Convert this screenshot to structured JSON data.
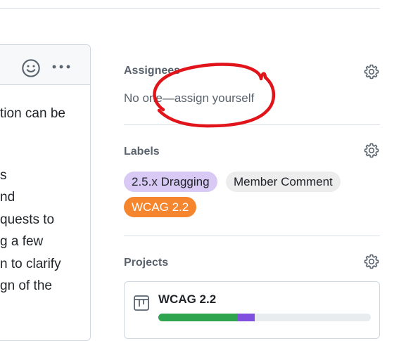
{
  "comment": {
    "lines": [
      "tion can be",
      "",
      "s",
      "nd",
      "quests to",
      "g a few",
      "n to clarify",
      "gn of the"
    ]
  },
  "sidebar": {
    "assignees": {
      "title": "Assignees",
      "empty_text": "No one—assign yourself"
    },
    "labels": {
      "title": "Labels",
      "items": [
        {
          "text": "2.5.x Dragging",
          "bg": "#d8c9f5",
          "fg": "#1f2328"
        },
        {
          "text": "Member Comment",
          "bg": "#ededed",
          "fg": "#1f2328"
        },
        {
          "text": "WCAG 2.2",
          "bg": "#f5862e",
          "fg": "#ffffff"
        }
      ]
    },
    "projects": {
      "title": "Projects",
      "items": [
        {
          "name": "WCAG 2.2",
          "progress": {
            "done": 0.375,
            "in_progress": 0.08
          }
        }
      ]
    }
  },
  "colors": {
    "annotation": "#e0141a",
    "progress_done": "#2ea44f",
    "progress_in_progress": "#8250df"
  },
  "icons": [
    "smiley-icon",
    "kebab-horizontal-icon",
    "gear-icon",
    "project-table-icon"
  ]
}
